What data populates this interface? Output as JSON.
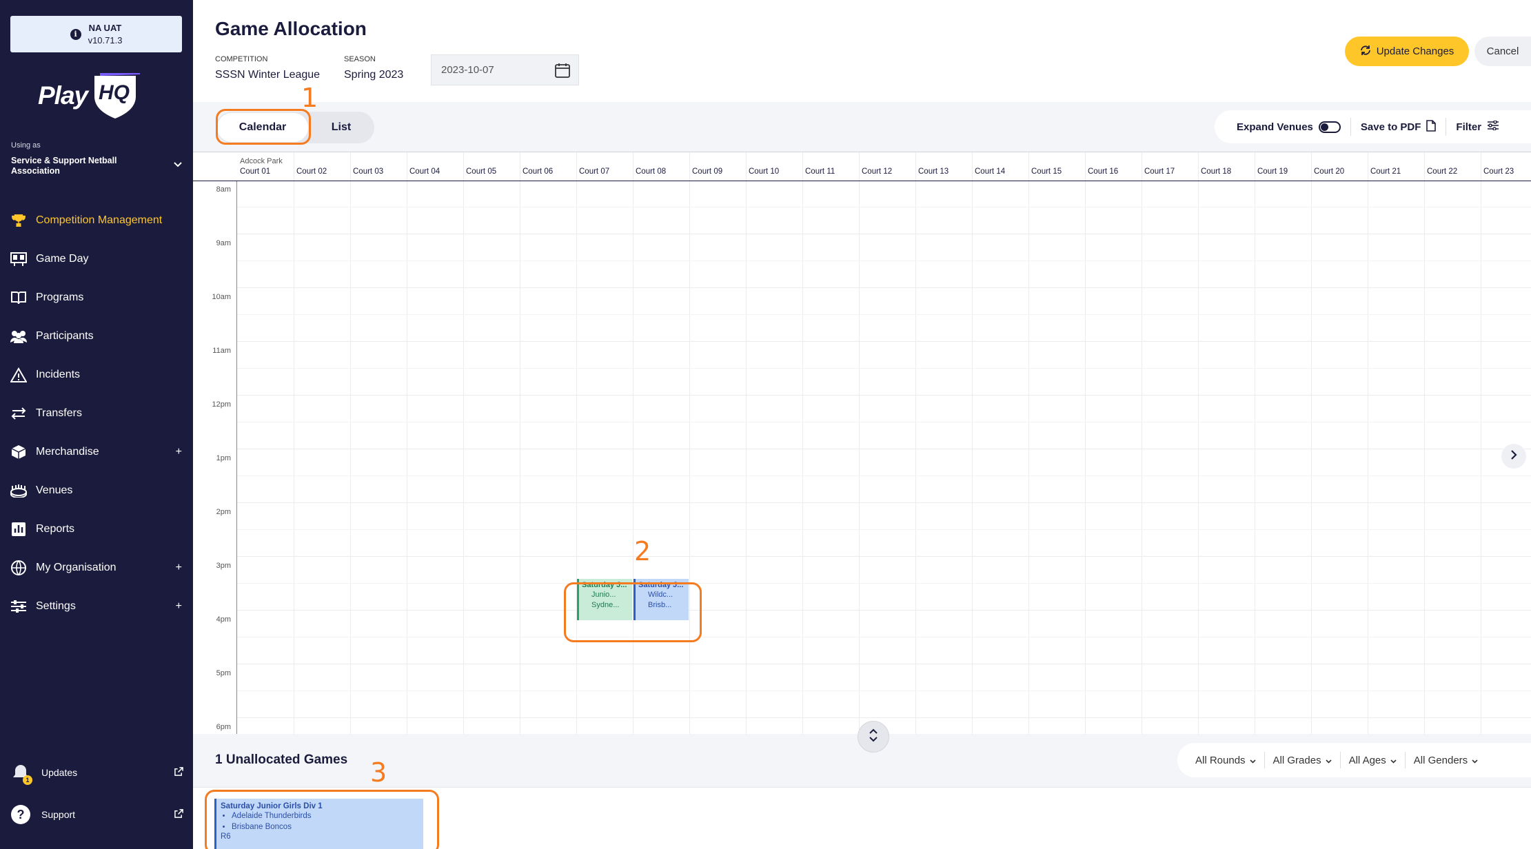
{
  "env": {
    "name": "NA UAT",
    "version": "v10.71.3"
  },
  "brand": {
    "logo_text": "Play",
    "logo_accent": "HQ",
    "primary": "#1b1b3d",
    "accent": "#ffc629"
  },
  "sidebar": {
    "using_as_label": "Using as",
    "org_name": "Service & Support Netball Association",
    "items": [
      {
        "label": "Competition Management",
        "icon": "trophy-icon",
        "active": true
      },
      {
        "label": "Game Day",
        "icon": "scoreboard-icon"
      },
      {
        "label": "Programs",
        "icon": "book-icon"
      },
      {
        "label": "Participants",
        "icon": "people-icon"
      },
      {
        "label": "Incidents",
        "icon": "warning-icon"
      },
      {
        "label": "Transfers",
        "icon": "transfer-icon"
      },
      {
        "label": "Merchandise",
        "icon": "box-icon",
        "expandable": true
      },
      {
        "label": "Venues",
        "icon": "stadium-icon"
      },
      {
        "label": "Reports",
        "icon": "report-icon"
      },
      {
        "label": "My Organisation",
        "icon": "globe-icon",
        "expandable": true
      },
      {
        "label": "Settings",
        "icon": "sliders-icon",
        "expandable": true
      }
    ],
    "updates_label": "Updates",
    "updates_badge": "1",
    "support_label": "Support"
  },
  "header": {
    "title": "Game Allocation",
    "competition_label": "COMPETITION",
    "competition_value": "SSSN Winter League",
    "season_label": "SEASON",
    "season_value": "Spring 2023",
    "date_value": "2023-10-07",
    "update_label": "Update Changes",
    "cancel_label": "Cancel"
  },
  "toolbar": {
    "calendar_label": "Calendar",
    "list_label": "List",
    "expand_venues_label": "Expand Venues",
    "save_pdf_label": "Save to PDF",
    "filter_label": "Filter"
  },
  "calendar": {
    "venue": "Adcock Park",
    "courts": [
      "Court 01",
      "Court 02",
      "Court 03",
      "Court 04",
      "Court 05",
      "Court 06",
      "Court 07",
      "Court 08",
      "Court 09",
      "Court 10",
      "Court 11",
      "Court 12",
      "Court 13",
      "Court 14",
      "Court 15",
      "Court 16",
      "Court 17",
      "Court 18",
      "Court 19",
      "Court 20",
      "Court 21",
      "Court 22",
      "Court 23"
    ],
    "times": [
      "8am",
      "9am",
      "10am",
      "11am",
      "12pm",
      "1pm",
      "2pm",
      "3pm",
      "4pm",
      "5pm",
      "6pm"
    ],
    "games": [
      {
        "title": "Saturday J...",
        "teams": [
          "Junio...",
          "Sydne..."
        ],
        "court_index": 6,
        "color": "#c9ecd8",
        "border": "#2e9e6a",
        "text": "#1f7a4f"
      },
      {
        "title": "Saturday J...",
        "teams": [
          "Wildc...",
          "Brisb..."
        ],
        "court_index": 7,
        "color": "#c2d8f8",
        "border": "#2b60c4",
        "text": "#2b4fa8"
      }
    ]
  },
  "unallocated": {
    "title": "1 Unallocated Games",
    "filters": [
      "All Rounds",
      "All Grades",
      "All Ages",
      "All Genders"
    ],
    "card": {
      "title": "Saturday Junior Girls Div 1",
      "teams": [
        "Adelaide Thunderbirds",
        "Brisbane Boncos"
      ],
      "round": "R6"
    }
  },
  "annotations": [
    "1",
    "2",
    "3"
  ]
}
